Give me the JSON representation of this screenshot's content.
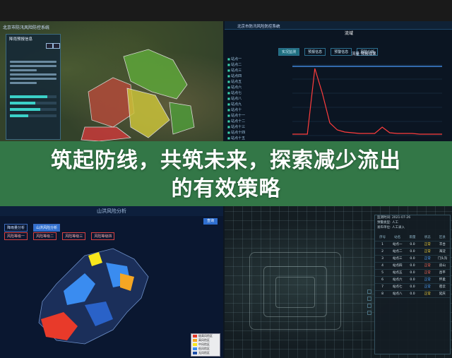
{
  "banner": {
    "line1": "筑起防线，共筑未来，探索减少流出",
    "line2": "的有效策略"
  },
  "tl": {
    "app_title": "北京市防汛风险防控系统",
    "panel_title": "降雨预报信息"
  },
  "tr": {
    "app_title": "北京市防汛风险防控系统",
    "section_title": "流域",
    "tabs": [
      "实况监测",
      "预报信息",
      "预警信息",
      "风险分析"
    ],
    "chart_title": "流量 预报成果",
    "stations": [
      "站点一",
      "站点二",
      "站点三",
      "站点四",
      "站点五",
      "站点六",
      "站点七",
      "站点八",
      "站点九",
      "站点十",
      "站点十一",
      "站点十二",
      "站点十三",
      "站点十四",
      "站点十五"
    ],
    "chart_data": {
      "type": "line",
      "x": [
        0,
        1,
        2,
        3,
        4,
        5,
        6,
        7,
        8,
        9,
        10,
        11,
        12,
        13,
        14,
        15,
        16,
        17,
        18,
        19,
        20
      ],
      "series": [
        {
          "values": [
            2,
            2,
            2,
            95,
            60,
            18,
            8,
            5,
            4,
            3,
            3,
            3,
            12,
            4,
            3,
            3,
            3,
            2,
            2,
            2,
            2
          ],
          "color": "#ff3d3d"
        },
        {
          "values": [
            98,
            98,
            98,
            98,
            98,
            98,
            98,
            98,
            98,
            98,
            98,
            98,
            98,
            98,
            98,
            98,
            98,
            98,
            98,
            98,
            98
          ],
          "color": "#4a9cff"
        }
      ],
      "ylim": [
        0,
        100
      ]
    }
  },
  "bl": {
    "title": "山洪风险分析",
    "tabs": [
      "降雨量分析",
      "山洪风险分析"
    ],
    "filters": [
      "风险等级一",
      "风险等级二",
      "风险等级三",
      "风险等级四"
    ],
    "button": "查询",
    "legend": [
      {
        "label": "极高风险区",
        "color": "#e83a2a"
      },
      {
        "label": "高风险区",
        "color": "#f5a623"
      },
      {
        "label": "中风险区",
        "color": "#f8e71c"
      },
      {
        "label": "低风险区",
        "color": "#3a8cf0"
      },
      {
        "label": "无风险区",
        "color": "#1e4fa8"
      }
    ]
  },
  "br": {
    "info": [
      "监测时间: 2021-07-26",
      "预警类型: 人工",
      "发布单位: 人工录入"
    ],
    "table_head": [
      "序号",
      "站名",
      "雨量",
      "状态",
      "区县"
    ],
    "rows": [
      {
        "no": "1",
        "name": "站点一",
        "val": "0.0",
        "status": "正常",
        "cls": "s-yellow",
        "area": "丰台"
      },
      {
        "no": "2",
        "name": "站点二",
        "val": "0.0",
        "status": "正常",
        "cls": "s-yellow",
        "area": "海淀"
      },
      {
        "no": "3",
        "name": "站点三",
        "val": "0.0",
        "status": "正常",
        "cls": "s-blue",
        "area": "门头沟"
      },
      {
        "no": "4",
        "name": "站点四",
        "val": "0.0",
        "status": "正常",
        "cls": "s-red",
        "area": "房山"
      },
      {
        "no": "5",
        "name": "站点五",
        "val": "0.0",
        "status": "正常",
        "cls": "s-red",
        "area": "昌平"
      },
      {
        "no": "6",
        "name": "站点六",
        "val": "0.0",
        "status": "正常",
        "cls": "s-blue",
        "area": "怀柔"
      },
      {
        "no": "7",
        "name": "站点七",
        "val": "0.0",
        "status": "正常",
        "cls": "s-blue",
        "area": "密云"
      },
      {
        "no": "8",
        "name": "站点八",
        "val": "0.0",
        "status": "正常",
        "cls": "s-yellow",
        "area": "延庆"
      }
    ]
  }
}
